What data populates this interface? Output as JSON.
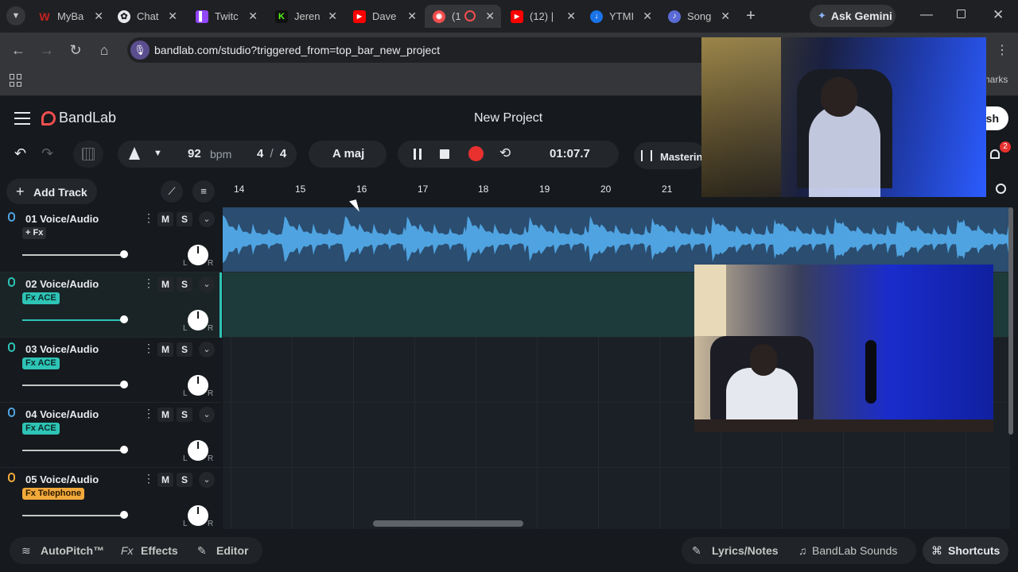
{
  "browser": {
    "tabs": [
      {
        "label": "MyBa",
        "icon": "mybandlab-icon",
        "color": "#c5221f"
      },
      {
        "label": "Chat",
        "icon": "chatgpt-icon",
        "color": "#e8eaed"
      },
      {
        "label": "Twitc",
        "icon": "twitch-icon",
        "color": "#9146ff"
      },
      {
        "label": "Jeren",
        "icon": "kick-icon",
        "color": "#53fc18"
      },
      {
        "label": "Dave",
        "icon": "youtube-icon",
        "color": "#ff0000"
      },
      {
        "label": "(1",
        "icon": "bandlab-icon",
        "color": "#f04e4e"
      },
      {
        "label": "(12) |",
        "icon": "youtube-icon",
        "color": "#ff0000"
      },
      {
        "label": "YTMI",
        "icon": "download-icon",
        "color": "#1a73e8"
      },
      {
        "label": "Song",
        "icon": "song-icon",
        "color": "#8ab4f8"
      }
    ],
    "ask_gemini": "Ask Gemini",
    "url": "bandlab.com/studio?triggered_from=top_bar_new_project",
    "bookmarks_fragment": "narks"
  },
  "app": {
    "logo": "BandLab",
    "project_title": "New Project",
    "publish_fragment": "sh",
    "notifications_count": "2",
    "transport": {
      "bpm_value": "92",
      "bpm_label": "bpm",
      "time_sig_top": "4",
      "time_sig_sep": "/",
      "time_sig_bottom": "4",
      "key": "A maj",
      "time": "01:07.7",
      "mastering": "Mastering"
    },
    "add_track": "Add Track",
    "ruler": [
      "14",
      "15",
      "16",
      "17",
      "18",
      "19",
      "20",
      "21"
    ],
    "tracks": [
      {
        "name": "01  Voice/Audio",
        "fx": "+ Fx",
        "fx_color": "#2a2e33",
        "fx_text": "#e8eaed",
        "mic_color": "#4fa3e0",
        "m": "M",
        "s": "S",
        "l": "L",
        "r": "R",
        "volume": 1.0
      },
      {
        "name": "02  Voice/Audio",
        "fx": "Fx ACE",
        "fx_color": "#2ec4b6",
        "fx_text": "#0b2b29",
        "mic_color": "#2ec4b6",
        "m": "M",
        "s": "S",
        "l": "L",
        "r": "R",
        "volume": 1.0
      },
      {
        "name": "03  Voice/Audio",
        "fx": "Fx ACE",
        "fx_color": "#2ec4b6",
        "fx_text": "#0b2b29",
        "mic_color": "#2ec4b6",
        "m": "M",
        "s": "S",
        "l": "L",
        "r": "R",
        "volume": 1.0
      },
      {
        "name": "04  Voice/Audio",
        "fx": "Fx ACE",
        "fx_color": "#2ec4b6",
        "fx_text": "#0b2b29",
        "mic_color": "#4fa3e0",
        "m": "M",
        "s": "S",
        "l": "L",
        "r": "R",
        "volume": 1.0
      },
      {
        "name": "05  Voice/Audio",
        "fx": "Fx Telephone",
        "fx_color": "#f2a93b",
        "fx_text": "#2a1a00",
        "mic_color": "#f2a93b",
        "m": "M",
        "s": "S",
        "l": "L",
        "r": "R",
        "volume": 1.0
      }
    ],
    "bottom": {
      "autopitch": "AutoPitch™",
      "effects": "Effects",
      "effects_prefix": "Fx",
      "editor": "Editor",
      "lyrics": "Lyrics/Notes",
      "sounds": "BandLab Sounds",
      "shortcuts": "Shortcuts"
    },
    "colors": {
      "accent_red": "#f04e4e",
      "waveform": "#4fa3e0",
      "record": "#e8312f"
    }
  }
}
